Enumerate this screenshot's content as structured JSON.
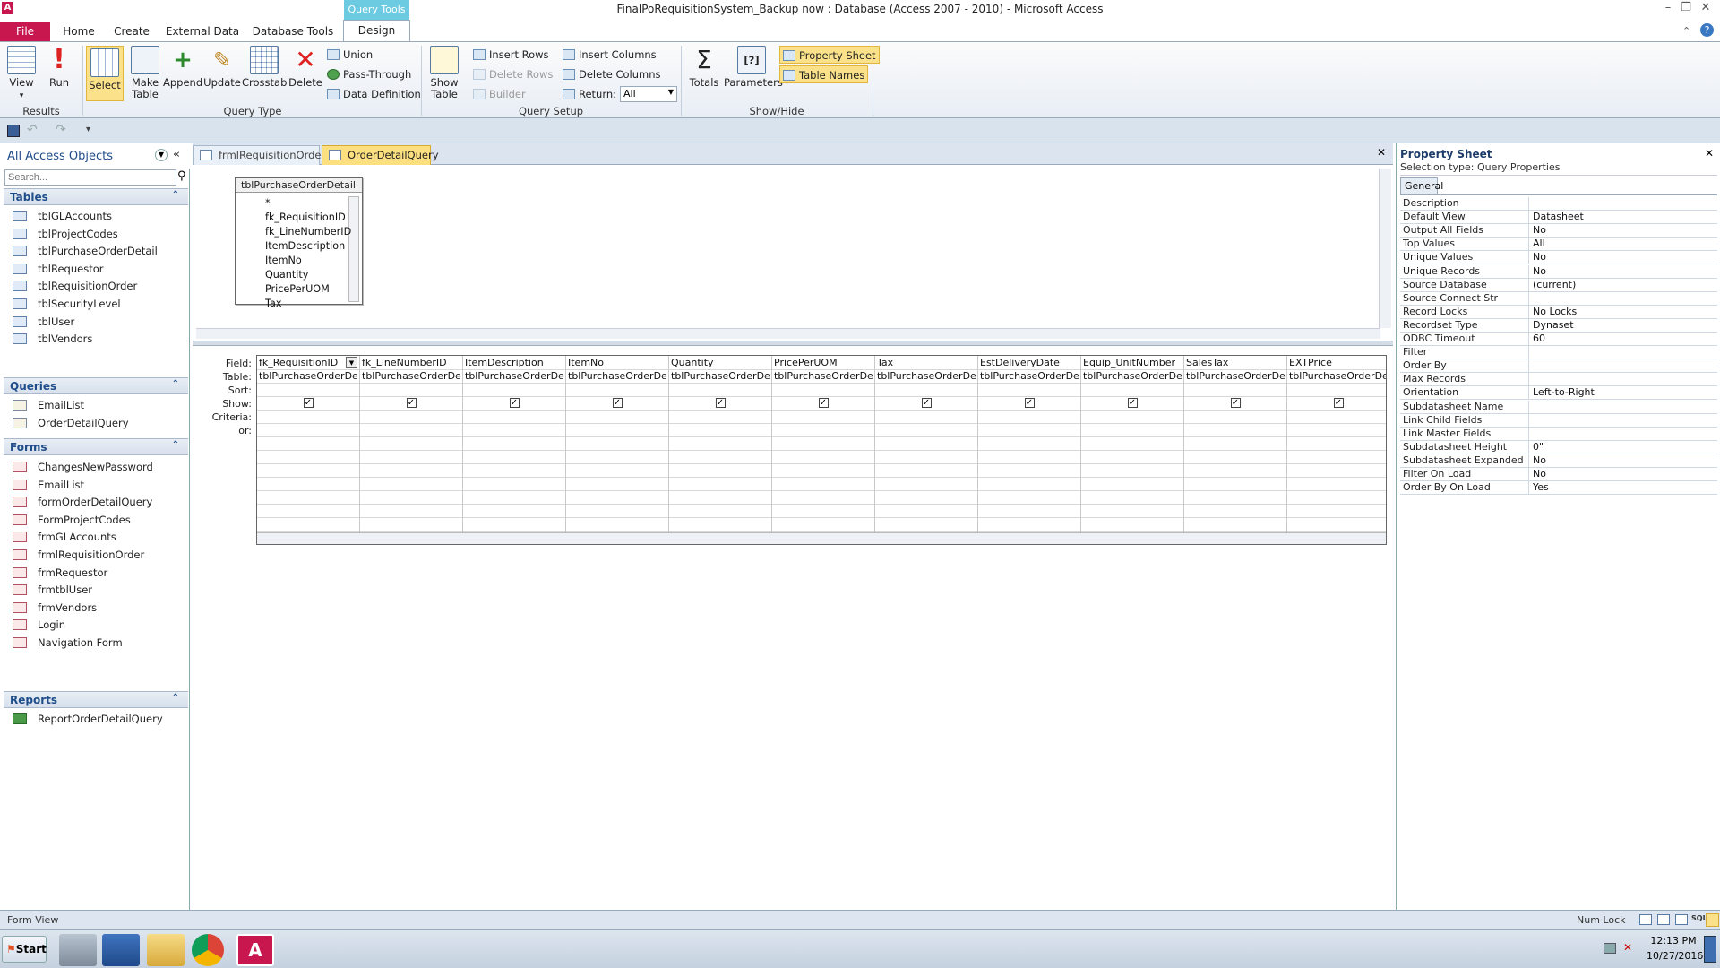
{
  "window": {
    "title": "FinalPoRequisitionSystem_Backup now : Database (Access 2007 - 2010) - Microsoft Access",
    "contextual_tab": "Query Tools"
  },
  "ribbon_tabs": [
    "File",
    "Home",
    "Create",
    "External Data",
    "Database Tools",
    "Design"
  ],
  "ribbon": {
    "results": {
      "label": "Results",
      "view": "View",
      "run": "Run"
    },
    "query_type": {
      "label": "Query Type",
      "select": "Select",
      "make_table": "Make Table",
      "append": "Append",
      "update": "Update",
      "crosstab": "Crosstab",
      "delete": "Delete",
      "union": "Union",
      "pass_through": "Pass-Through",
      "data_definition": "Data Definition"
    },
    "query_setup": {
      "label": "Query Setup",
      "show_table": "Show Table",
      "insert_rows": "Insert Rows",
      "delete_rows": "Delete Rows",
      "builder": "Builder",
      "insert_columns": "Insert Columns",
      "delete_columns": "Delete Columns",
      "return_label": "Return:",
      "return_value": "All"
    },
    "show_hide": {
      "label": "Show/Hide",
      "totals": "Totals",
      "parameters": "Parameters",
      "property_sheet": "Property Sheet",
      "table_names": "Table Names"
    }
  },
  "nav": {
    "header": "All Access Objects",
    "search_placeholder": "Search...",
    "tables_label": "Tables",
    "tables": [
      "tblGLAccounts",
      "tblProjectCodes",
      "tblPurchaseOrderDetail",
      "tblRequestor",
      "tblRequisitionOrder",
      "tblSecurityLevel",
      "tblUser",
      "tblVendors"
    ],
    "queries_label": "Queries",
    "queries": [
      "EmailList",
      "OrderDetailQuery"
    ],
    "forms_label": "Forms",
    "forms": [
      "ChangesNewPassword",
      "EmailList",
      "formOrderDetailQuery",
      "FormProjectCodes",
      "frmGLAccounts",
      "frmlRequisitionOrder",
      "frmRequestor",
      "frmtblUser",
      "frmVendors",
      "Login",
      "Navigation Form"
    ],
    "reports_label": "Reports",
    "reports": [
      "ReportOrderDetailQuery"
    ]
  },
  "doc_tabs": [
    "frmlRequisitionOrder",
    "OrderDetailQuery"
  ],
  "table_box": {
    "title": "tblPurchaseOrderDetail",
    "fields": [
      "*",
      "fk_RequisitionID",
      "fk_LineNumberID",
      "ItemDescription",
      "ItemNo",
      "Quantity",
      "PricePerUOM",
      "Tax"
    ]
  },
  "grid": {
    "row_labels": [
      "Field:",
      "Table:",
      "Sort:",
      "Show:",
      "Criteria:",
      "or:"
    ],
    "columns": [
      {
        "field": "fk_RequisitionID",
        "table": "tblPurchaseOrderDetail",
        "show": true
      },
      {
        "field": "fk_LineNumberID",
        "table": "tblPurchaseOrderDetail",
        "show": true
      },
      {
        "field": "ItemDescription",
        "table": "tblPurchaseOrderDetail",
        "show": true
      },
      {
        "field": "ItemNo",
        "table": "tblPurchaseOrderDetail",
        "show": true
      },
      {
        "field": "Quantity",
        "table": "tblPurchaseOrderDetail",
        "show": true
      },
      {
        "field": "PricePerUOM",
        "table": "tblPurchaseOrderDetail",
        "show": true
      },
      {
        "field": "Tax",
        "table": "tblPurchaseOrderDetail",
        "show": true
      },
      {
        "field": "EstDeliveryDate",
        "table": "tblPurchaseOrderDetail",
        "show": true
      },
      {
        "field": "Equip_UnitNumber",
        "table": "tblPurchaseOrderDetail",
        "show": true
      },
      {
        "field": "SalesTax",
        "table": "tblPurchaseOrderDetail",
        "show": true
      },
      {
        "field": "EXTPrice",
        "table": "tblPurchaseOrderDetail",
        "show": true
      }
    ]
  },
  "property_sheet": {
    "title": "Property Sheet",
    "selection_type": "Selection type:  Query Properties",
    "tab": "General",
    "properties": [
      {
        "name": "Description",
        "value": ""
      },
      {
        "name": "Default View",
        "value": "Datasheet"
      },
      {
        "name": "Output All Fields",
        "value": "No"
      },
      {
        "name": "Top Values",
        "value": "All"
      },
      {
        "name": "Unique Values",
        "value": "No"
      },
      {
        "name": "Unique Records",
        "value": "No"
      },
      {
        "name": "Source Database",
        "value": "(current)"
      },
      {
        "name": "Source Connect Str",
        "value": ""
      },
      {
        "name": "Record Locks",
        "value": "No Locks"
      },
      {
        "name": "Recordset Type",
        "value": "Dynaset"
      },
      {
        "name": "ODBC Timeout",
        "value": "60"
      },
      {
        "name": "Filter",
        "value": ""
      },
      {
        "name": "Order By",
        "value": ""
      },
      {
        "name": "Max Records",
        "value": ""
      },
      {
        "name": "Orientation",
        "value": "Left-to-Right"
      },
      {
        "name": "Subdatasheet Name",
        "value": ""
      },
      {
        "name": "Link Child Fields",
        "value": ""
      },
      {
        "name": "Link Master Fields",
        "value": ""
      },
      {
        "name": "Subdatasheet Height",
        "value": "0\""
      },
      {
        "name": "Subdatasheet Expanded",
        "value": "No"
      },
      {
        "name": "Filter On Load",
        "value": "No"
      },
      {
        "name": "Order By On Load",
        "value": "Yes"
      }
    ]
  },
  "status": {
    "left": "Form View",
    "num_lock": "Num Lock"
  },
  "taskbar": {
    "start": "Start",
    "time": "12:13 PM",
    "date": "10/27/2016"
  },
  "colors": {
    "file_tab": "#c8174e",
    "active_doc_tab": "#fce07f",
    "query_tools": "#6ccbe0"
  }
}
